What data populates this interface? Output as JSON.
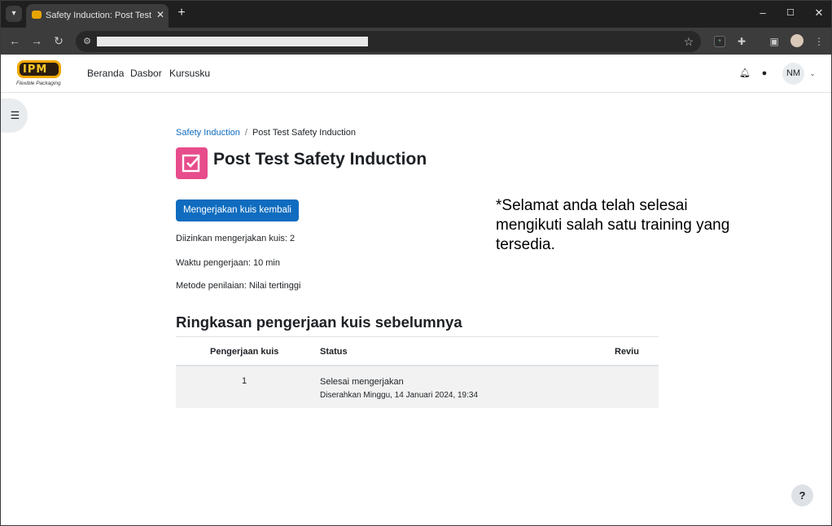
{
  "browser": {
    "tab_title": "Safety Induction: Post Test Safety Induction",
    "tab_search_icon": "chevron-down-icon",
    "close_tab": "✕",
    "new_tab": "+",
    "window_controls": {
      "minimize": "–",
      "maximize": "☐",
      "close": "✕"
    },
    "nav": {
      "back": "←",
      "forward": "→",
      "reload": "↻"
    },
    "url": "",
    "toolbar_icons": [
      "extension-sheet-icon",
      "puzzle-icon",
      "side-panel-icon",
      "profile-icon",
      "kebab-menu-icon"
    ]
  },
  "site": {
    "logo_mark": "IPM",
    "logo_tagline": "Flexible Packaging",
    "nav": [
      "Beranda",
      "Dasbor",
      "Kursusku"
    ],
    "user_initials": "NM"
  },
  "breadcrumb": {
    "course": "Safety Induction",
    "separator": "/",
    "current": "Post Test Safety Induction"
  },
  "page": {
    "title": "Post Test Safety Induction",
    "reattempt_button": "Mengerjakan kuis kembali",
    "info": [
      "Diizinkan mengerjakan kuis: 2",
      "Waktu pengerjaan: 10 min",
      "Metode penilaian: Nilai tertinggi"
    ],
    "note": "*Selamat anda telah selesai mengikuti salah satu training yang tersedia."
  },
  "summary": {
    "title": "Ringkasan pengerjaan kuis sebelumnya",
    "headers": {
      "attempt": "Pengerjaan kuis",
      "status": "Status",
      "review": "Reviu"
    },
    "rows": [
      {
        "attempt": "1",
        "status": "Selesai mengerjakan",
        "submitted": "Diserahkan Minggu, 14 Januari 2024, 19:34",
        "review": ""
      }
    ]
  },
  "help": "?"
}
